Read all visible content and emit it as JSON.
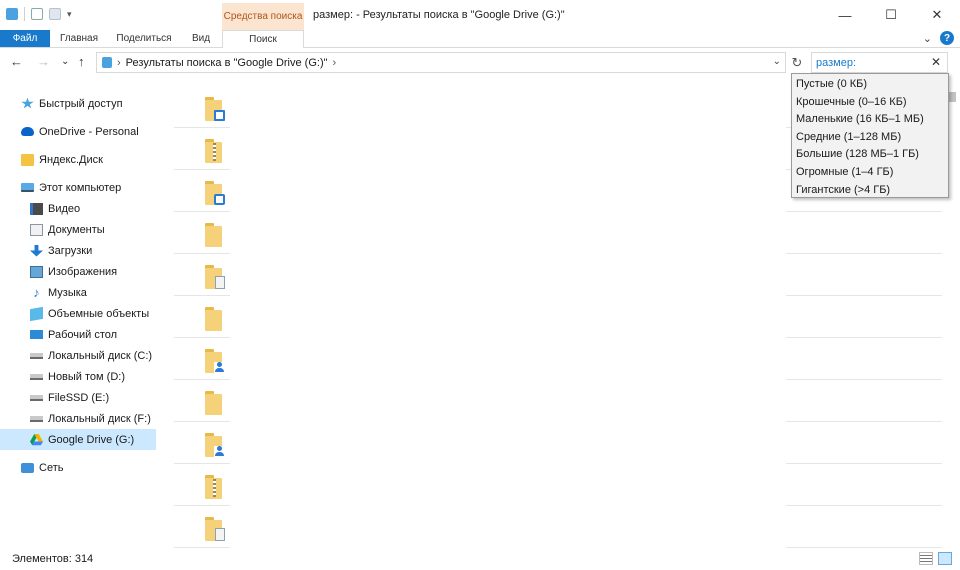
{
  "window": {
    "title": "размер: - Результаты поиска в \"Google Drive (G:)\"",
    "context_tab_header": "Средства поиска",
    "controls": {
      "minimize": "—",
      "maximize": "☐",
      "close": "✕"
    }
  },
  "ribbon": {
    "tabs": {
      "file": "Файл",
      "home": "Главная",
      "share": "Поделиться",
      "view": "Вид",
      "search": "Поиск"
    },
    "help": "?",
    "collapse": "⌄"
  },
  "address": {
    "path": "Результаты поиска в \"Google Drive (G:)\"",
    "separator": "›",
    "back": "←",
    "forward": "→",
    "recent": "⌄",
    "up": "↑",
    "dropdown": "⌄",
    "refresh": "↻"
  },
  "search": {
    "value": "размер:",
    "clear": "✕"
  },
  "nav": {
    "quick_access": "Быстрый доступ",
    "onedrive": "OneDrive - Personal",
    "yandex": "Яндекс.Диск",
    "this_pc": "Этот компьютер",
    "video": "Видео",
    "documents": "Документы",
    "downloads": "Загрузки",
    "pictures": "Изображения",
    "music": "Музыка",
    "objects3d": "Объемные объекты",
    "desktop": "Рабочий стол",
    "disk_c": "Локальный диск (C:)",
    "disk_d": "Новый том (D:)",
    "disk_e": "FileSSD (E:)",
    "disk_f": "Локальный диск (F:)",
    "disk_g": "Google Drive (G:)",
    "network": "Сеть"
  },
  "size_filter": {
    "items": [
      "Пустые (0 КБ)",
      "Крошечные (0–16 КБ)",
      "Маленькие (16 КБ–1 МБ)",
      "Средние (1–128 МБ)",
      "Большие (128 МБ–1 ГБ)",
      "Огромные (1–4 ГБ)",
      "Гигантские (>4 ГБ)"
    ]
  },
  "status": {
    "count": "Элементов: 314"
  }
}
